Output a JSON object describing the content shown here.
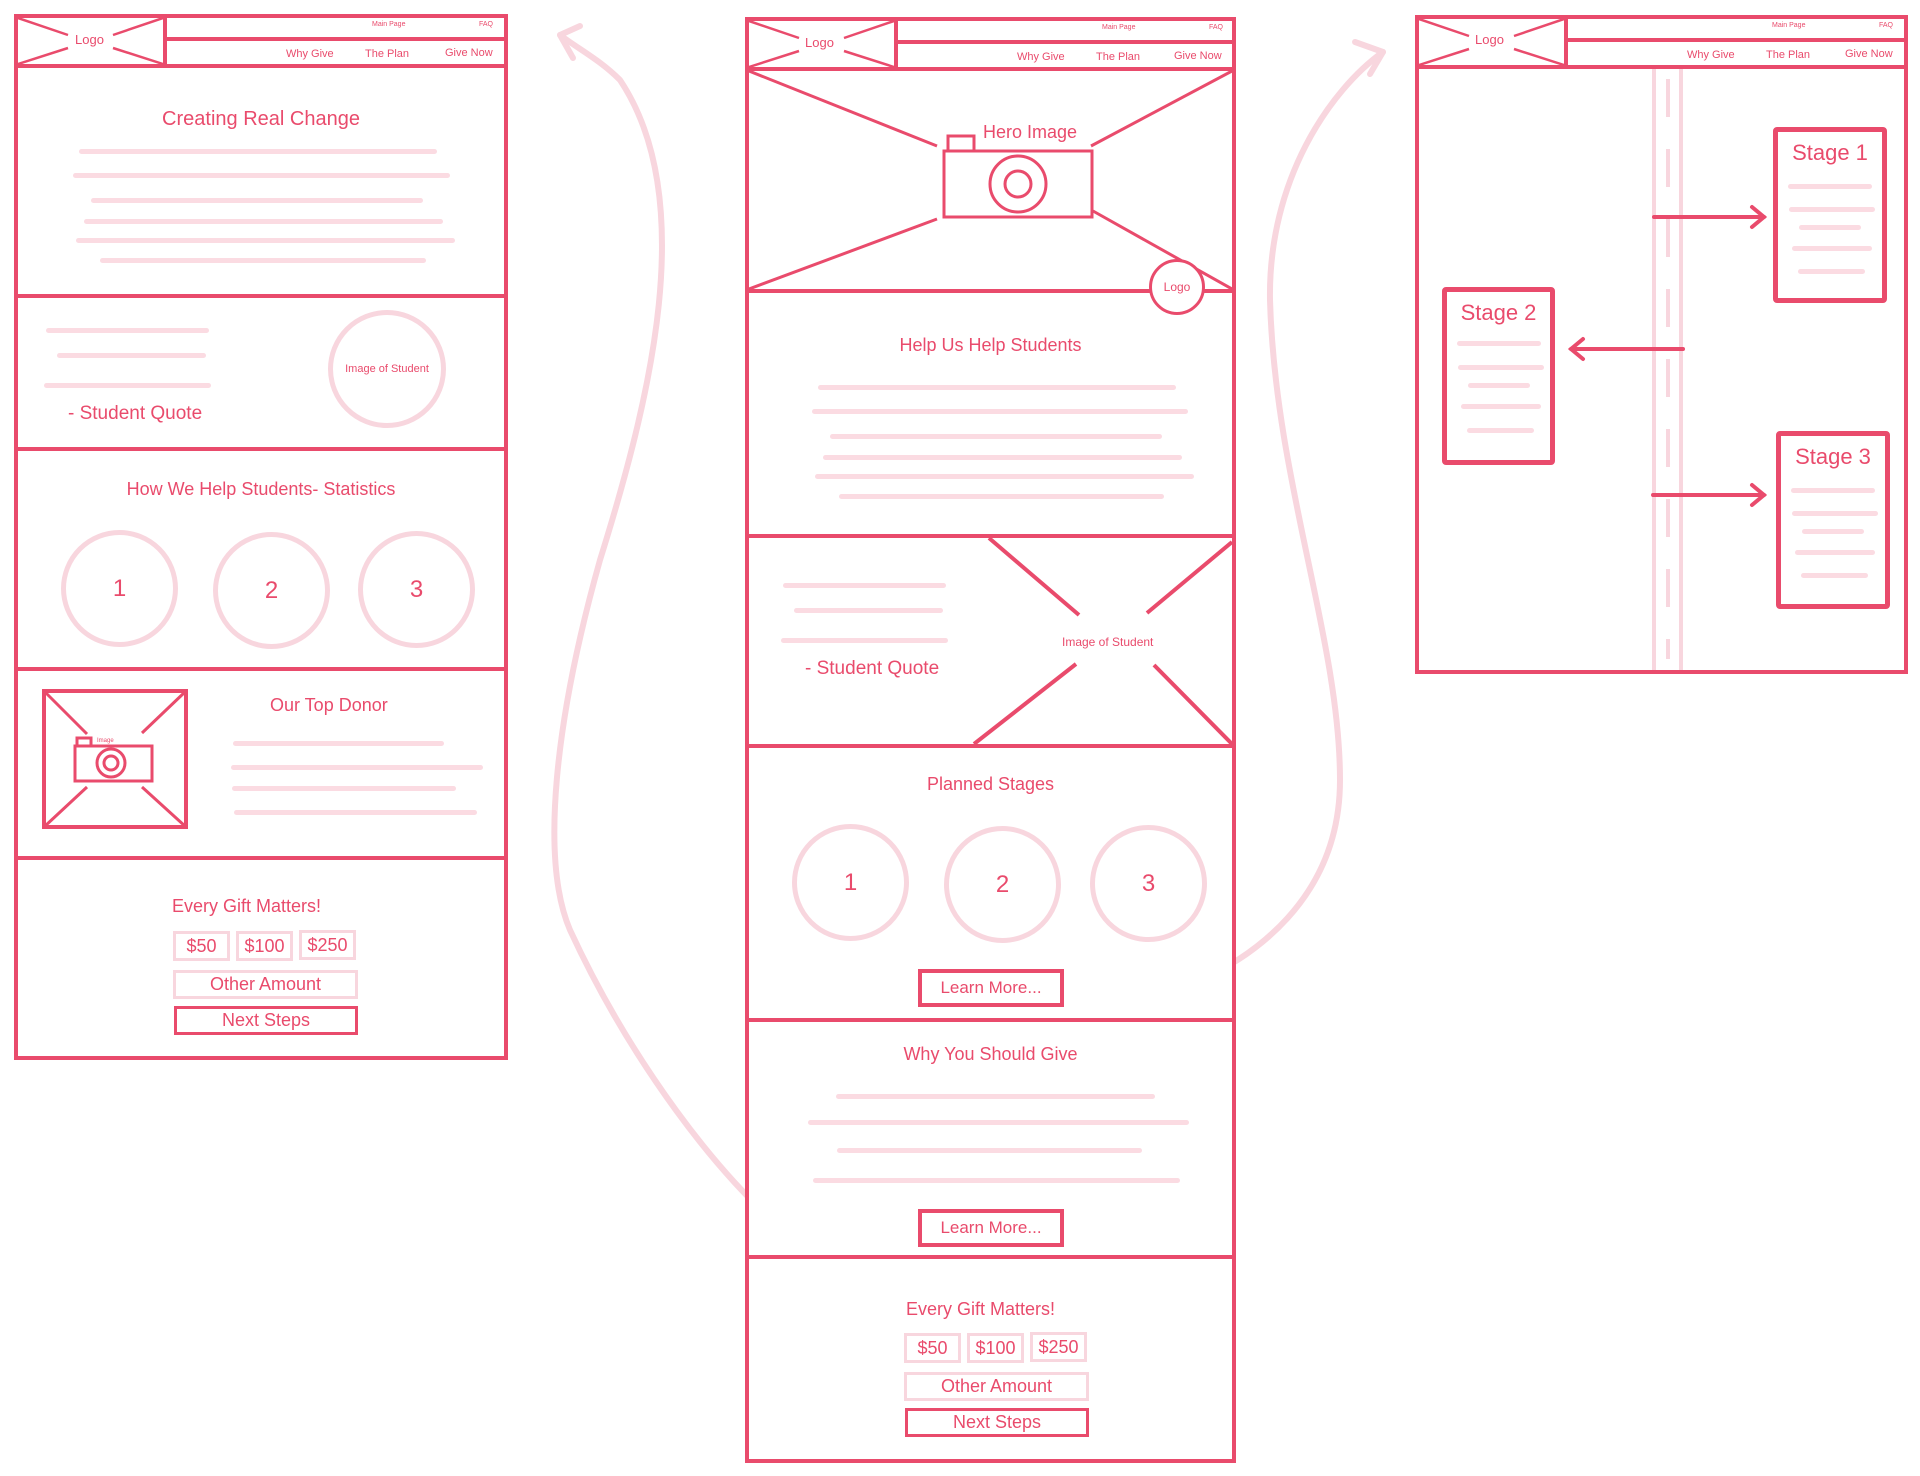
{
  "colors": {
    "accent": "#e94b6c",
    "soft": "#f8d6de",
    "placeholder_line": "#fbdbe2",
    "background": "#ffffff"
  },
  "nav": {
    "logo": "Logo",
    "top_links": [
      "Main Page",
      "FAQ"
    ],
    "main_links": [
      "Why Give",
      "The Plan",
      "Give Now"
    ]
  },
  "left_page": {
    "hero_title": "Creating Real Change",
    "quote_label": "- Student Quote",
    "student_image_label": "Image of Student",
    "stats_title": "How We Help Students- Statistics",
    "stats": [
      "1",
      "2",
      "3"
    ],
    "donor_title": "Our Top Donor",
    "donor_image_label": "Image",
    "gift": {
      "title": "Every Gift Matters!",
      "amounts": [
        "$50",
        "$100",
        "$250"
      ],
      "other": "Other Amount",
      "next": "Next Steps"
    }
  },
  "middle_page": {
    "hero_label": "Hero Image",
    "hero_logo": "Logo",
    "help_title": "Help Us Help Students",
    "quote_label": "- Student Quote",
    "student_image_label": "Image of Student",
    "stages_title": "Planned Stages",
    "stages": [
      "1",
      "2",
      "3"
    ],
    "learn_more": "Learn More...",
    "why_title": "Why You Should Give",
    "learn_more_2": "Learn More...",
    "gift": {
      "title": "Every Gift Matters!",
      "amounts": [
        "$50",
        "$100",
        "$250"
      ],
      "other": "Other Amount",
      "next": "Next Steps"
    }
  },
  "right_page": {
    "stages": [
      "Stage 1",
      "Stage 2",
      "Stage 3"
    ]
  },
  "connectors": [
    {
      "from": "middle_page",
      "to": "left_page",
      "direction": "left"
    },
    {
      "from": "middle_page.planned_stages",
      "to": "right_page",
      "direction": "right"
    }
  ]
}
